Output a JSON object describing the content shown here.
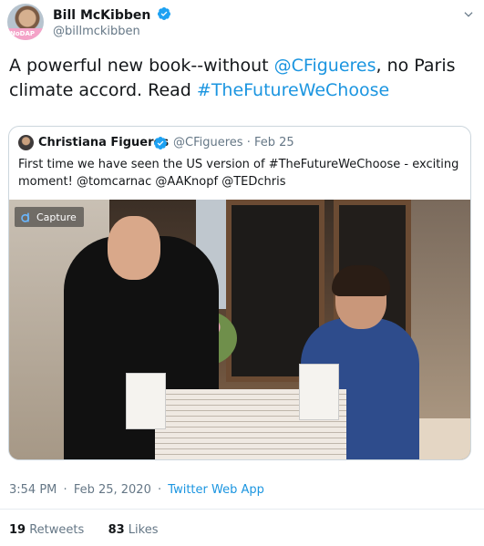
{
  "author": {
    "name": "Bill McKibben",
    "handle": "@billmckibben",
    "avatar_badge": "NoDAP"
  },
  "tweet": {
    "text_parts": [
      {
        "text": "A powerful new book--without ",
        "link": false
      },
      {
        "text": "@CFigueres",
        "link": true
      },
      {
        "text": ", no Paris climate accord. Read ",
        "link": false
      },
      {
        "text": "#TheFutureWeChoose",
        "link": true
      }
    ]
  },
  "quote": {
    "name": "Christiana Figueres",
    "handle": "@CFigueres",
    "dot": "·",
    "date": "Feb 25",
    "text": "First time we have seen the US version of #TheFutureWeChoose - exciting moment! @tomcarnac @AAKnopf @TEDchris",
    "media_overlay": "Capture"
  },
  "meta": {
    "time": "3:54 PM",
    "date": "Feb 25, 2020",
    "source": "Twitter Web App",
    "sep": "·"
  },
  "stats": {
    "retweets_count": "19",
    "retweets_label": "Retweets",
    "likes_count": "83",
    "likes_label": "Likes"
  },
  "colors": {
    "link": "#1b95e0",
    "verified": "#1da1f2",
    "secondary_text": "#657786"
  },
  "icons": [
    "verified-icon",
    "chevron-down-icon",
    "capture-logo-icon"
  ]
}
